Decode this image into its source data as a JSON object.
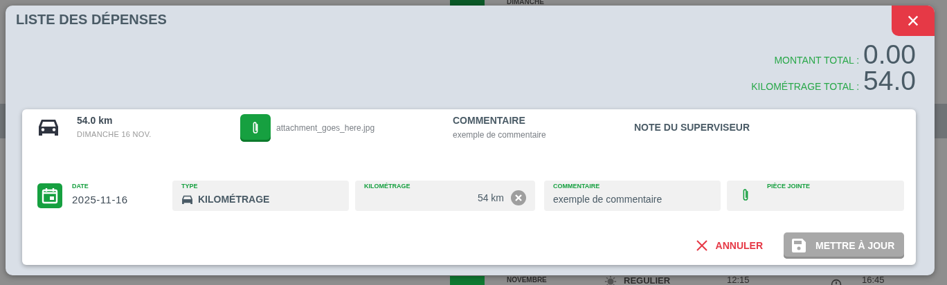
{
  "backdrop": {
    "top_labels": [
      "DIMANCHE"
    ],
    "bottom_labels": [
      {
        "kind": "month",
        "text": "NOVEMBRE"
      },
      {
        "kind": "shift",
        "text": "REGULIER"
      },
      {
        "kind": "start",
        "text": "12:15"
      },
      {
        "kind": "end",
        "text": "16:45"
      }
    ]
  },
  "dialog": {
    "title": "LISTE DES DÉPENSES",
    "totals": [
      {
        "label": "MONTANT TOTAL :",
        "value": "0.00"
      },
      {
        "label": "KILOMÉTRAGE TOTAL :",
        "value": "54.0"
      }
    ],
    "expense": {
      "distance": "54.0 km",
      "date": "DIMANCHE 16 NOV.",
      "attachment": "attachment_goes_here.jpg",
      "comment_heading": "COMMENTAIRE",
      "comment": "exemple de commentaire",
      "supervisor_heading": "NOTE DU SUPERVISEUR"
    },
    "form": {
      "date_label": "DATE",
      "date_value": "2025-11-16",
      "fields": [
        {
          "kind": "select",
          "label": "TYPE",
          "value": "KILOMÉTRAGE"
        },
        {
          "kind": "number",
          "label": "KILOMÉTRAGE",
          "value": "54 km"
        },
        {
          "kind": "text",
          "label": "COMMENTAIRE",
          "value": "exemple de commentaire"
        },
        {
          "kind": "file",
          "label": "PIÈCE JOINTE"
        }
      ]
    },
    "buttons": [
      {
        "kind": "cancel",
        "label": "ANNULER",
        "disabled": false
      },
      {
        "kind": "save",
        "label": "METTRE À JOUR",
        "disabled": true
      }
    ]
  }
}
